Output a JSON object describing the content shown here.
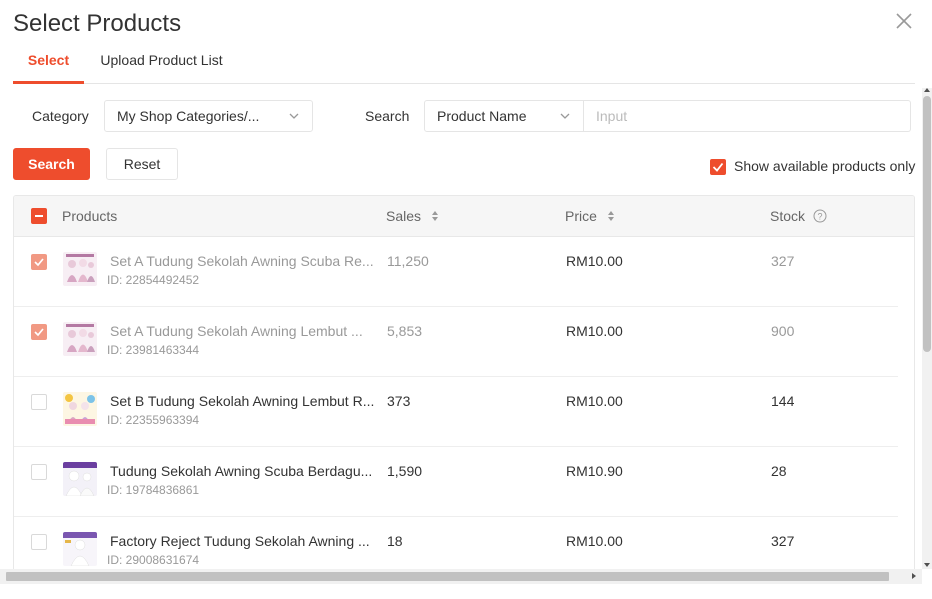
{
  "dialog": {
    "title": "Select Products"
  },
  "tabs": [
    {
      "label": "Select",
      "active": true
    },
    {
      "label": "Upload Product List",
      "active": false
    }
  ],
  "filters": {
    "category_label": "Category",
    "category_value": "My Shop Categories/...",
    "search_label": "Search",
    "search_field": "Product Name",
    "search_placeholder": "Input",
    "search_button": "Search",
    "reset_button": "Reset",
    "available_only_label": "Show available products only",
    "available_only_checked": true
  },
  "table": {
    "headers": {
      "products": "Products",
      "sales": "Sales",
      "price": "Price",
      "stock": "Stock"
    },
    "select_all_state": "indeterminate",
    "rows": [
      {
        "name": "Set A Tudung Sekolah Awning Scuba Re...",
        "id": "ID: 22854492452",
        "sales": "11,250",
        "price": "RM10.00",
        "stock": "327",
        "checked": true,
        "disabled": true
      },
      {
        "name": "Set A Tudung Sekolah Awning Lembut ...",
        "id": "ID: 23981463344",
        "sales": "5,853",
        "price": "RM10.00",
        "stock": "900",
        "checked": true,
        "disabled": true
      },
      {
        "name": "Set B Tudung Sekolah Awning Lembut R...",
        "id": "ID: 22355963394",
        "sales": "373",
        "price": "RM10.00",
        "stock": "144",
        "checked": false,
        "disabled": false
      },
      {
        "name": "Tudung Sekolah Awning Scuba Berdagu...",
        "id": "ID: 19784836861",
        "sales": "1,590",
        "price": "RM10.90",
        "stock": "28",
        "checked": false,
        "disabled": false
      },
      {
        "name": "Factory Reject Tudung Sekolah Awning ...",
        "id": "ID: 29008631674",
        "sales": "18",
        "price": "RM10.00",
        "stock": "327",
        "checked": false,
        "disabled": false
      }
    ]
  },
  "colors": {
    "accent": "#ee4d2d",
    "text": "#333333",
    "muted": "#999999",
    "border": "#e5e5e5"
  }
}
